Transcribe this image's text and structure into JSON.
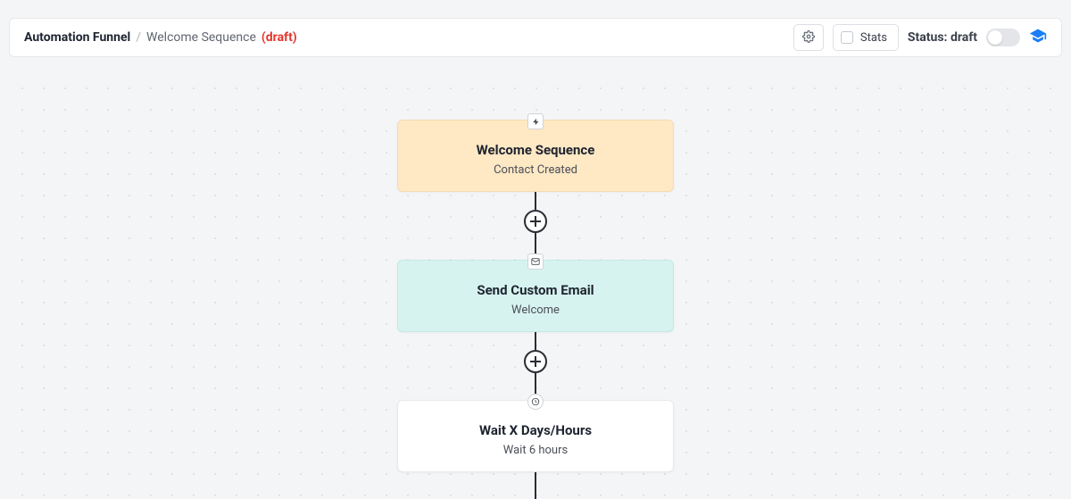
{
  "header": {
    "breadcrumb": {
      "root": "Automation Funnel",
      "separator": "/",
      "name": "Welcome Sequence",
      "status_tag": "(draft)"
    },
    "stats_label": "Stats",
    "status_prefix": "Status: ",
    "status_value": "draft"
  },
  "flow": {
    "nodes": [
      {
        "type": "trigger",
        "icon": "bolt-icon",
        "title": "Welcome Sequence",
        "subtitle": "Contact Created"
      },
      {
        "type": "email",
        "icon": "email-icon",
        "title": "Send Custom Email",
        "subtitle": "Welcome"
      },
      {
        "type": "wait",
        "icon": "clock-icon",
        "title": "Wait X Days/Hours",
        "subtitle": "Wait 6 hours"
      }
    ]
  }
}
